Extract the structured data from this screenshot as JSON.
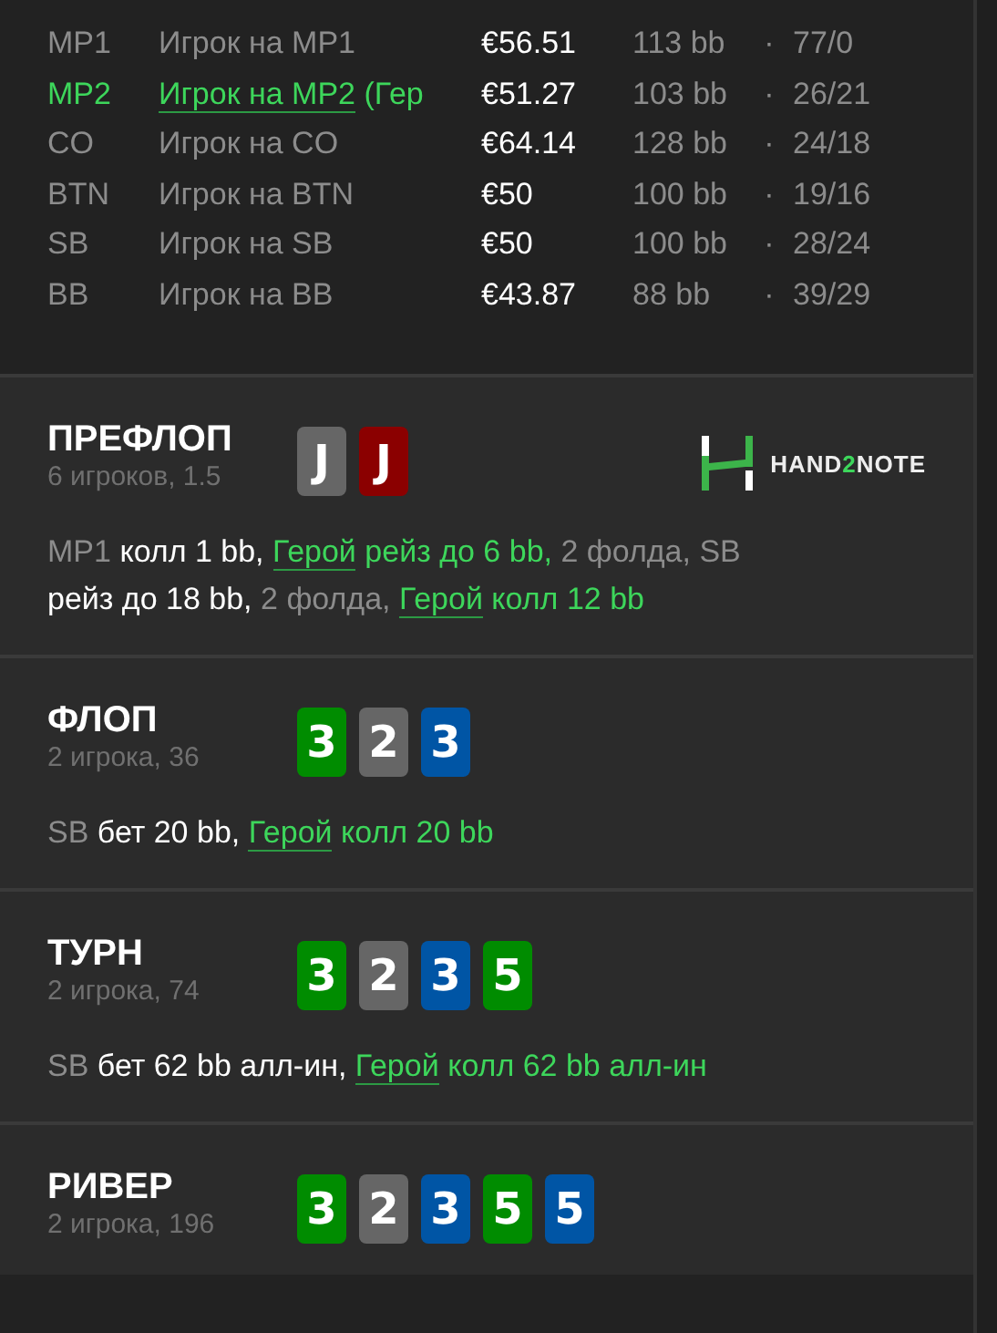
{
  "players": [
    {
      "position": "MP1",
      "name": "Игрок на MP1",
      "hero": false,
      "stack": "€56.51",
      "bb": "113 bb",
      "separator": "·",
      "stats": "77/0"
    },
    {
      "position": "MP2",
      "name": "Игрок на MP2",
      "name_suffix": " (Гер",
      "hero": true,
      "stack": "€51.27",
      "bb": "103 bb",
      "separator": "·",
      "stats": "26/21"
    },
    {
      "position": "CO",
      "name": "Игрок на CO",
      "hero": false,
      "stack": "€64.14",
      "bb": "128 bb",
      "separator": "·",
      "stats": "24/18"
    },
    {
      "position": "BTN",
      "name": "Игрок на BTN",
      "hero": false,
      "stack": "€50",
      "bb": "100 bb",
      "separator": "·",
      "stats": "19/16"
    },
    {
      "position": "SB",
      "name": "Игрок на SB",
      "hero": false,
      "stack": "€50",
      "bb": "100 bb",
      "separator": "·",
      "stats": "28/24"
    },
    {
      "position": "BB",
      "name": "Игрок на BB",
      "hero": false,
      "stack": "€43.87",
      "bb": "88 bb",
      "separator": "·",
      "stats": "39/29"
    }
  ],
  "streets": [
    {
      "title": "ПРЕФЛОП",
      "subtitle": "6 игроков, 1.5",
      "logo": {
        "prefix": "HAND",
        "accent": "2",
        "suffix": "NOTE"
      },
      "cards": [
        {
          "rank": "J",
          "color": "#666666"
        },
        {
          "rank": "J",
          "color": "#8b0000"
        }
      ],
      "actions": [
        {
          "kind": "actor",
          "text": "MP1 "
        },
        {
          "kind": "action",
          "text": "колл 1 bb, "
        },
        {
          "kind": "hero",
          "text": "Герой"
        },
        {
          "kind": "hero_action",
          "text": " рейз до 6 bb, "
        },
        {
          "kind": "fold",
          "text": "2 фолда, SB "
        },
        {
          "kind": "action",
          "text": "рейз до 18 bb, "
        },
        {
          "kind": "fold",
          "text": "2 фолда, "
        },
        {
          "kind": "hero",
          "text": "Герой"
        },
        {
          "kind": "hero_action",
          "text": " колл 12 bb"
        }
      ]
    },
    {
      "title": "ФЛОП",
      "subtitle": "2 игрока, 36",
      "cards": [
        {
          "rank": "3",
          "color": "#008c00"
        },
        {
          "rank": "2",
          "color": "#666666"
        },
        {
          "rank": "3",
          "color": "#0055a5"
        }
      ],
      "actions": [
        {
          "kind": "actor",
          "text": "SB "
        },
        {
          "kind": "action",
          "text": "бет 20 bb, "
        },
        {
          "kind": "hero",
          "text": "Герой"
        },
        {
          "kind": "hero_action",
          "text": " колл 20 bb"
        }
      ]
    },
    {
      "title": "ТУРН",
      "subtitle": "2 игрока, 74",
      "cards": [
        {
          "rank": "3",
          "color": "#008c00"
        },
        {
          "rank": "2",
          "color": "#666666"
        },
        {
          "rank": "3",
          "color": "#0055a5"
        },
        {
          "rank": "5",
          "color": "#008c00"
        }
      ],
      "actions": [
        {
          "kind": "actor",
          "text": "SB "
        },
        {
          "kind": "action",
          "text": "бет 62 bb алл-ин, "
        },
        {
          "kind": "hero",
          "text": "Герой"
        },
        {
          "kind": "hero_action",
          "text": " колл 62 bb алл-ин"
        }
      ]
    },
    {
      "title": "РИВЕР",
      "subtitle": "2 игрока, 196",
      "cards": [
        {
          "rank": "3",
          "color": "#008c00"
        },
        {
          "rank": "2",
          "color": "#666666"
        },
        {
          "rank": "3",
          "color": "#0055a5"
        },
        {
          "rank": "5",
          "color": "#008c00"
        },
        {
          "rank": "5",
          "color": "#0055a5"
        }
      ]
    }
  ]
}
